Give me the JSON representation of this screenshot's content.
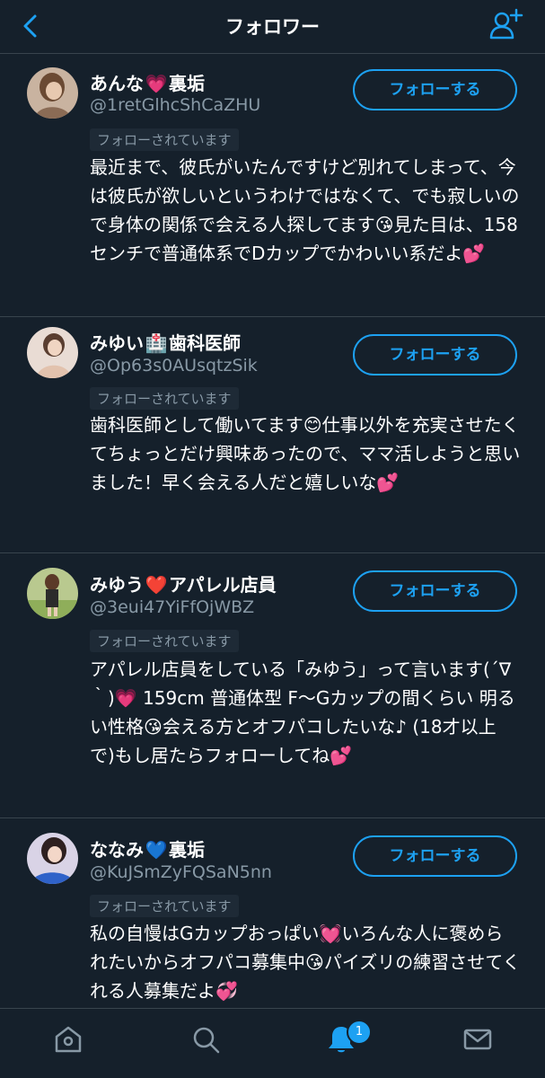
{
  "header": {
    "title": "フォロワー"
  },
  "colors": {
    "background": "#15202b",
    "accent": "#1da1f2",
    "muted": "#8899a6",
    "divider": "#38444d"
  },
  "followers": [
    {
      "name": "あんな",
      "emoji": "💗",
      "tag": "裏垢",
      "handle": "@1retGlhcShCaZHU",
      "follows_you": "フォローされています",
      "follow_button": "フォローする",
      "bio": "最近まで、彼氏がいたんですけど別れてしまって、今は彼氏が欲しいというわけではなくて、でも寂しいので身体の関係で会える人探してます😘見た目は、158センチで普通体系でDカップでかわいい系だよ💕"
    },
    {
      "name": "みゆい",
      "emoji": "🏥",
      "tag": "歯科医師",
      "handle": "@Op63s0AUsqtzSik",
      "follows_you": "フォローされています",
      "follow_button": "フォローする",
      "bio": "歯科医師として働いてます😊仕事以外を充実させたくてちょっとだけ興味あったので、ママ活しようと思いました！早く会える人だと嬉しいな💕"
    },
    {
      "name": "みゆう",
      "emoji": "❤️",
      "tag": "アパレル店員",
      "handle": "@3eui47YiFfOjWBZ",
      "follows_you": "フォローされています",
      "follow_button": "フォローする",
      "bio": "アパレル店員をしている「みゆう」って言います(´∇｀)💗 159cm 普通体型 F〜Gカップの間くらい 明るい性格😘会える方とオフパコしたいな♪ (18才以上で)もし居たらフォローしてね💕"
    },
    {
      "name": "ななみ",
      "emoji": "💙",
      "tag": "裏垢",
      "handle": "@KuJSmZyFQSaN5nn",
      "follows_you": "フォローされています",
      "follow_button": "フォローする",
      "bio": "私の自慢はGカップおっぱい💓いろんな人に褒められたいからオフパコ募集中😘パイズリの練習させてくれる人募集だよ💞"
    }
  ],
  "tabbar": {
    "tabs": [
      {
        "icon": "home-icon"
      },
      {
        "icon": "search-icon"
      },
      {
        "icon": "bell-icon"
      },
      {
        "icon": "mail-icon"
      }
    ],
    "notification_count": "1"
  }
}
